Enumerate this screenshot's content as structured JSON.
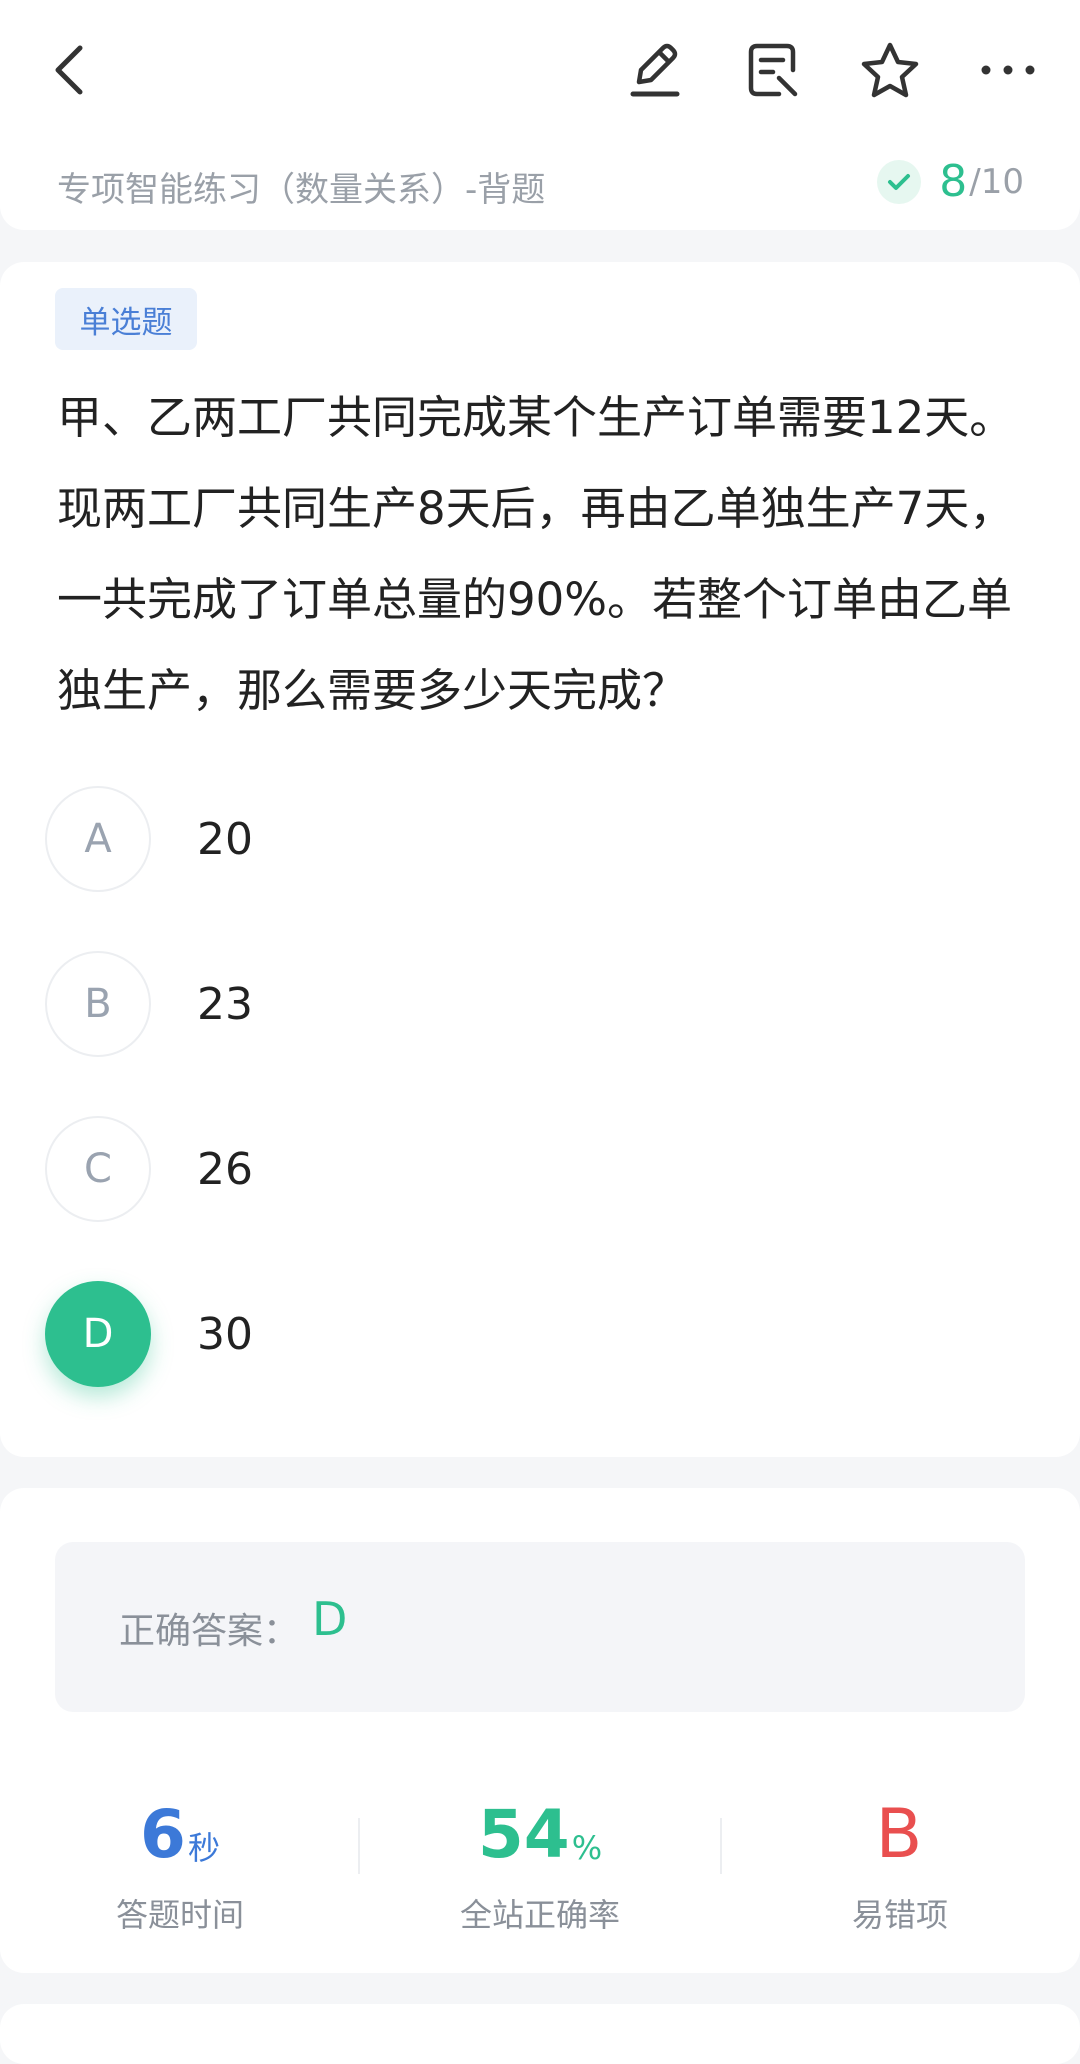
{
  "header": {
    "subtitle": "专项智能练习（数量关系）-背题",
    "progress_current": "8",
    "progress_total": "/10",
    "icons": [
      "back-icon",
      "pen-icon",
      "answer-sheet-icon",
      "star-icon",
      "more-icon"
    ]
  },
  "question": {
    "type_badge": "单选题",
    "text": "甲、乙两工厂共同完成某个生产订单需要12天。现两工厂共同生产8天后，再由乙单独生产7天，一共完成了订单总量的90%。若整个订单由乙单独生产，那么需要多少天完成？",
    "options": [
      {
        "letter": "A",
        "value": "20"
      },
      {
        "letter": "B",
        "value": "23"
      },
      {
        "letter": "C",
        "value": "26"
      },
      {
        "letter": "D",
        "value": "30"
      }
    ],
    "selected": "D"
  },
  "analysis": {
    "correct_label": "正确答案：",
    "correct_value": "D",
    "stats": [
      {
        "value": "6",
        "unit": "秒",
        "label": "答题时间",
        "color": "#3c79d8"
      },
      {
        "value": "54",
        "unit": "%",
        "label": "全站正确率",
        "color": "#2dbf8f"
      },
      {
        "value": "B",
        "unit": "",
        "label": "易错项",
        "color": "#e94f4f"
      }
    ]
  },
  "colors": {
    "accent": "#2dbf8f",
    "blue": "#3c79d8",
    "red": "#e94f4f"
  }
}
